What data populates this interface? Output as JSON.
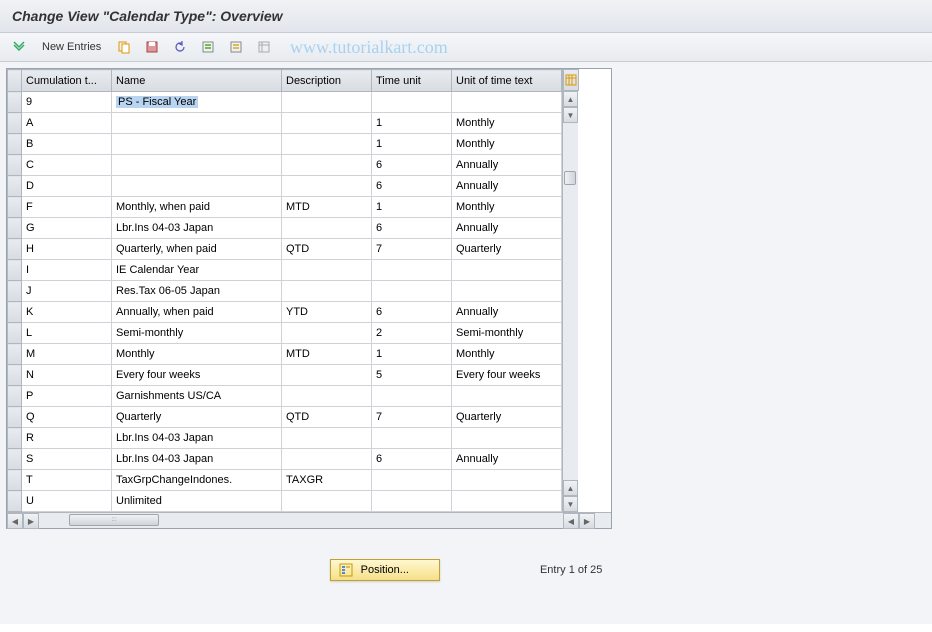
{
  "title": "Change View \"Calendar Type\": Overview",
  "toolbar": {
    "new_entries_label": "New Entries"
  },
  "watermark": "www.tutorialkart.com",
  "columns": {
    "cumulation": "Cumulation t...",
    "name": "Name",
    "description": "Description",
    "time_unit": "Time unit",
    "unit_text": "Unit of time text"
  },
  "rows": [
    {
      "cumul": "9",
      "name": "PS - Fiscal Year",
      "desc": "",
      "time": "",
      "unit": "",
      "highlight": true
    },
    {
      "cumul": "A",
      "name": "",
      "desc": "",
      "time": "1",
      "unit": "Monthly"
    },
    {
      "cumul": "B",
      "name": "",
      "desc": "",
      "time": "1",
      "unit": "Monthly"
    },
    {
      "cumul": "C",
      "name": "",
      "desc": "",
      "time": "6",
      "unit": "Annually"
    },
    {
      "cumul": "D",
      "name": "",
      "desc": "",
      "time": "6",
      "unit": "Annually"
    },
    {
      "cumul": "F",
      "name": "Monthly, when paid",
      "desc": "MTD",
      "time": "1",
      "unit": "Monthly"
    },
    {
      "cumul": "G",
      "name": "Lbr.Ins 04-03  Japan",
      "desc": "",
      "time": "6",
      "unit": "Annually"
    },
    {
      "cumul": "H",
      "name": "Quarterly, when paid",
      "desc": "QTD",
      "time": "7",
      "unit": "Quarterly"
    },
    {
      "cumul": "I",
      "name": "IE Calendar Year",
      "desc": "",
      "time": "",
      "unit": ""
    },
    {
      "cumul": "J",
      "name": "Res.Tax 06-05  Japan",
      "desc": "",
      "time": "",
      "unit": ""
    },
    {
      "cumul": "K",
      "name": "Annually, when paid",
      "desc": "YTD",
      "time": "6",
      "unit": "Annually"
    },
    {
      "cumul": "L",
      "name": "Semi-monthly",
      "desc": "",
      "time": "2",
      "unit": "Semi-monthly"
    },
    {
      "cumul": "M",
      "name": "Monthly",
      "desc": "MTD",
      "time": "1",
      "unit": "Monthly"
    },
    {
      "cumul": "N",
      "name": "Every four weeks",
      "desc": "",
      "time": "5",
      "unit": "Every four weeks"
    },
    {
      "cumul": "P",
      "name": "Garnishments US/CA",
      "desc": "",
      "time": "",
      "unit": ""
    },
    {
      "cumul": "Q",
      "name": "Quarterly",
      "desc": "QTD",
      "time": "7",
      "unit": "Quarterly"
    },
    {
      "cumul": "R",
      "name": "Lbr.Ins 04-03  Japan",
      "desc": "",
      "time": "",
      "unit": ""
    },
    {
      "cumul": "S",
      "name": "Lbr.Ins 04-03  Japan",
      "desc": "",
      "time": "6",
      "unit": "Annually"
    },
    {
      "cumul": "T",
      "name": "TaxGrpChangeIndones.",
      "desc": "TAXGR",
      "time": "",
      "unit": ""
    },
    {
      "cumul": "U",
      "name": "Unlimited",
      "desc": "",
      "time": "",
      "unit": ""
    }
  ],
  "footer": {
    "position_label": "Position...",
    "entry_text": "Entry 1 of 25"
  }
}
